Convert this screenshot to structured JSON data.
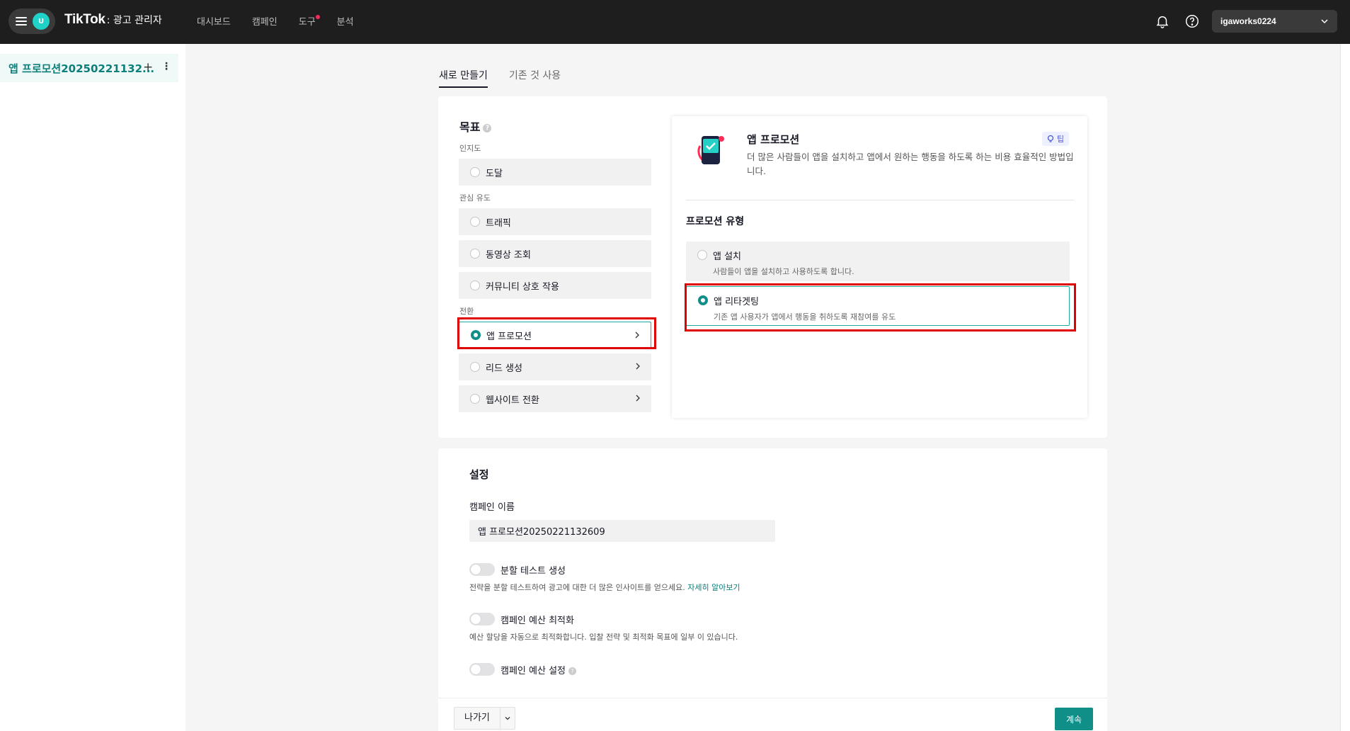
{
  "header": {
    "brand": "TikTok",
    "product": ": 광고 관리자",
    "avatar_initial": "U",
    "nav": [
      "대시보드",
      "캠페인",
      "도구",
      "분석"
    ],
    "account": "igaworks0224"
  },
  "sidebar": {
    "campaign_name": "앱 프로모션20250221132...",
    "add": "+",
    "more": "⋮"
  },
  "tabs": [
    "새로 만들기",
    "기존 것 사용"
  ],
  "objective": {
    "title": "목표",
    "groups": {
      "awareness": "인지도",
      "consideration": "관심 유도",
      "conversion": "전환"
    },
    "options": {
      "reach": "도달",
      "traffic": "트래픽",
      "video_views": "동영상 조회",
      "community": "커뮤니티 상호 작용",
      "app_promotion": "앱 프로모션",
      "lead_gen": "리드 생성",
      "website_conversion": "웹사이트 전환"
    }
  },
  "detail": {
    "title": "앱 프로모션",
    "tip": "팁",
    "description": "더 많은 사람들이 앱을 설치하고 앱에서 원하는 행동을 하도록 하는 비용 효율적인 방법입니다.",
    "promo_type_title": "프로모션 유형",
    "app_install": {
      "label": "앱 설치",
      "desc": "사람들이 앱을 설치하고 사용하도록 합니다."
    },
    "app_retargeting": {
      "label": "앱 리타겟팅",
      "desc": "기존 앱 사용자가 앱에서 행동을 취하도록 재참여를 유도"
    }
  },
  "settings": {
    "title": "설정",
    "campaign_name_label": "캠페인 이름",
    "campaign_name_value": "앱 프로모션20250221132609",
    "split_test": {
      "label": "분할 테스트 생성",
      "desc": "전략을 분할 테스트하여 광고에 대한 더 많은 인사이트를 얻으세요.",
      "link": "자세히 알아보기"
    },
    "budget_opt": {
      "label": "캠페인 예산 최적화",
      "desc": "예산 할당을 자동으로 최적화합니다. 입찰 전략 및 최적화 목표에 일부 이 있습니다."
    },
    "budget_set": {
      "label": "캠페인 예산 설정"
    }
  },
  "footer": {
    "exit": "나가기",
    "continue": "계속"
  },
  "colors": {
    "accent": "#0f8f88",
    "highlight": "#e10000",
    "topbar": "#1e1e1e"
  }
}
